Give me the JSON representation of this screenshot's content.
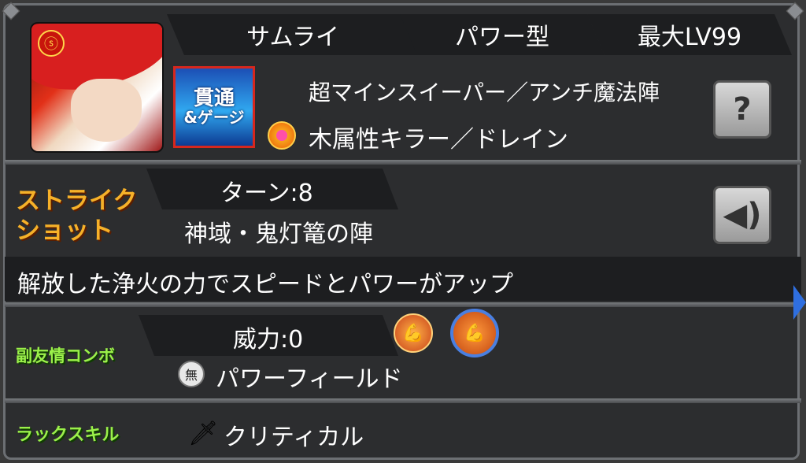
{
  "monster": {
    "race": "サムライ",
    "type": "パワー型",
    "max_level": "最大LV99",
    "gauge_badge": {
      "line1": "貫通",
      "line2": "&ゲージ"
    },
    "ability_1": "超マインスイーパー／アンチ魔法陣",
    "ability_2": "木属性キラー／ドレイン",
    "help_icon": "question-icon"
  },
  "strike_shot": {
    "label": "ストライク\nショット",
    "turns": "ターン:8",
    "name": "神域・鬼灯篭の陣",
    "description": "解放した浄火の力でスピードとパワーがアップ",
    "voice_icon": "speaker-icon"
  },
  "sub_friendship": {
    "label": "副友情コンボ",
    "power": "威力:0",
    "icon_badge": "無",
    "name": "パワーフィールド"
  },
  "luck_skill": {
    "label": "ラックスキル",
    "name": "クリティカル"
  },
  "colors": {
    "panel": "#2c2d2f",
    "slot": "#1d1e20",
    "strike_label": "#f6b129",
    "green_label": "#9bf04a",
    "gauge_blue": "#1c4fb5"
  }
}
